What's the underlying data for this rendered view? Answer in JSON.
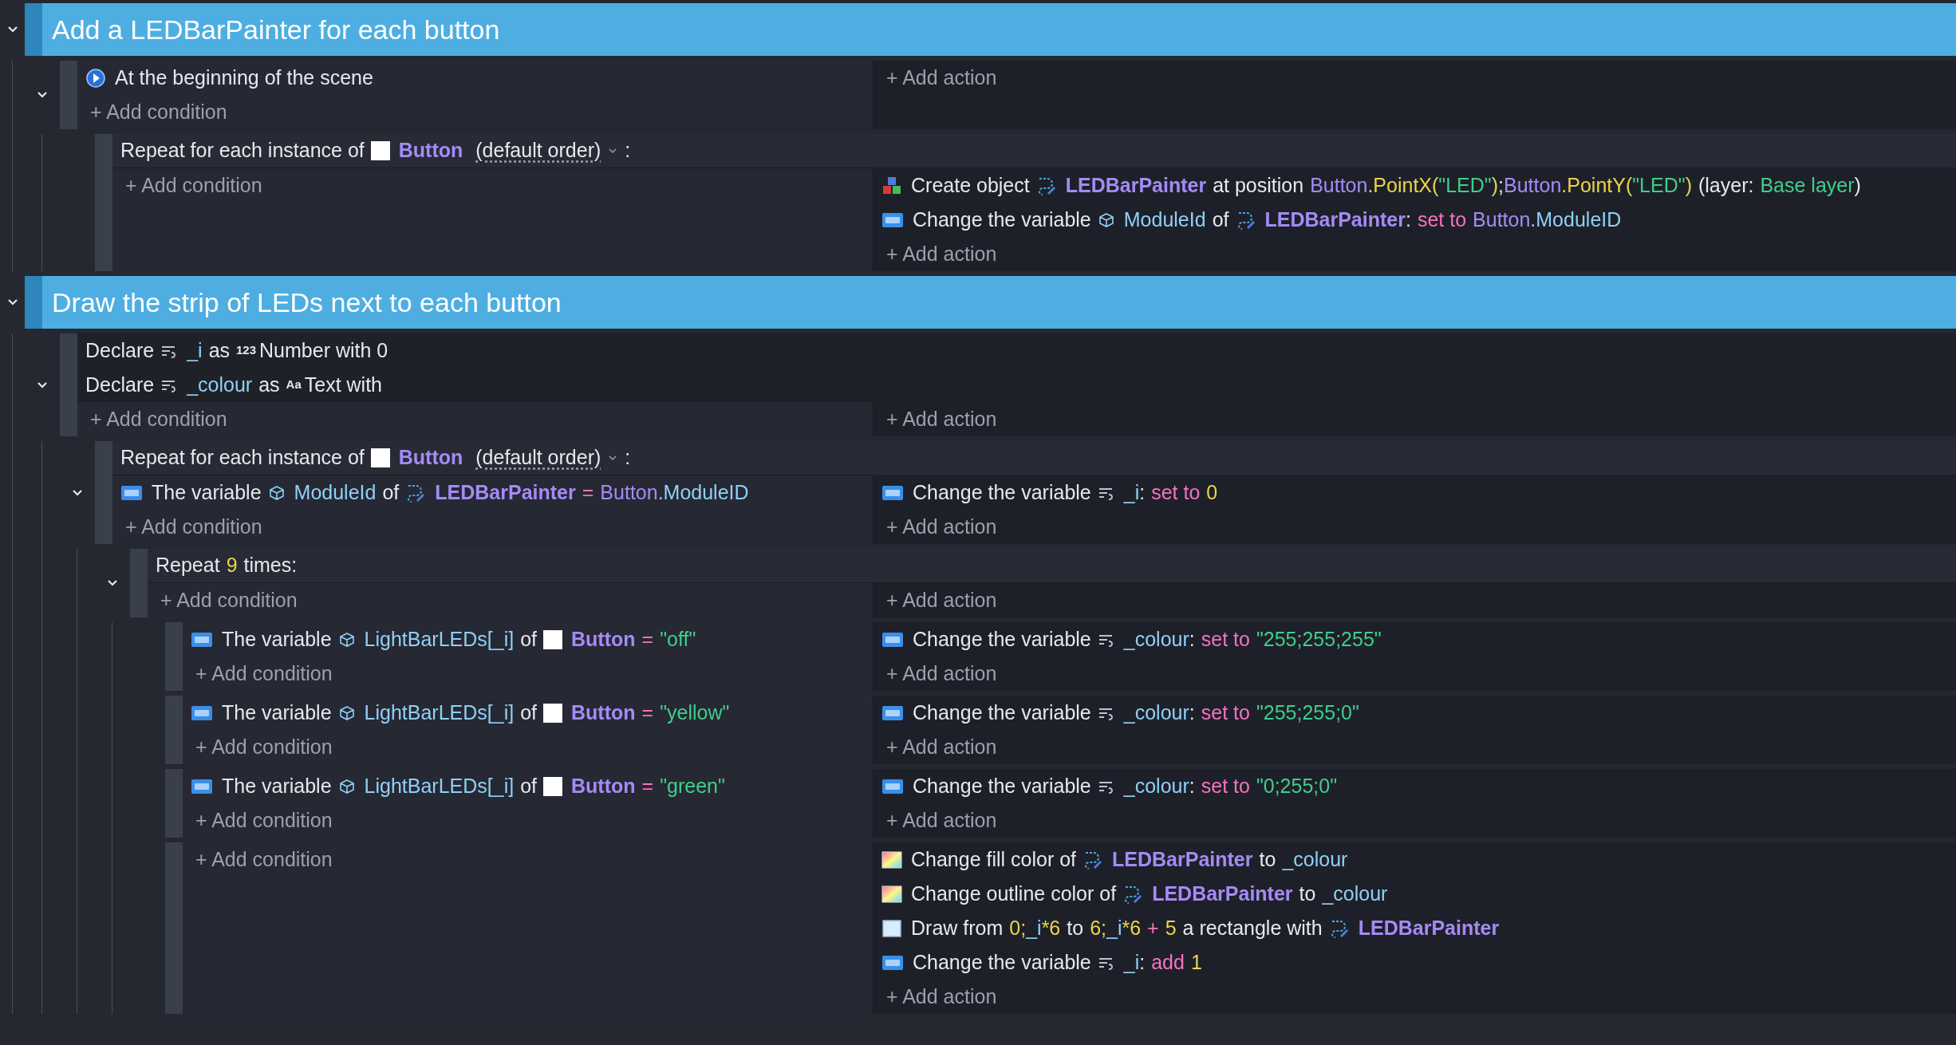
{
  "events": [
    {
      "kind": "comment",
      "text": "Add a LEDBarPainter for each button",
      "expanded": true,
      "children": [
        {
          "kind": "standard",
          "expanded": true,
          "conditions": [
            {
              "kind": "play",
              "parts": [
                {
                  "kind": "text",
                  "text": "At the beginning of the scene"
                }
              ]
            }
          ],
          "add_condition": "+ Add condition",
          "add_action": "+ Add action",
          "children": [
            {
              "kind": "foreach",
              "header": [
                {
                  "kind": "text",
                  "text": "Repeat for each instance of"
                },
                {
                  "kind": "sprite",
                  "text": "Button"
                },
                {
                  "kind": "order",
                  "text": "(default order)"
                },
                {
                  "kind": "caret"
                },
                {
                  "kind": "text",
                  "text": ":"
                }
              ],
              "add_condition": "+ Add condition",
              "actions": [
                {
                  "kind": "create",
                  "parts": [
                    {
                      "kind": "text",
                      "text": "Create object"
                    },
                    {
                      "kind": "painter",
                      "text": "LEDBarPainter"
                    },
                    {
                      "kind": "text",
                      "text": "at position"
                    },
                    {
                      "kind": "expr",
                      "tokens": [
                        {
                          "kind": "obj",
                          "text": "Button"
                        },
                        {
                          "kind": "fn",
                          "text": ".PointX("
                        },
                        {
                          "kind": "str",
                          "text": "\"LED\""
                        },
                        {
                          "kind": "fn",
                          "text": ")"
                        },
                        {
                          "kind": "plain",
                          "text": ";"
                        },
                        {
                          "kind": "obj",
                          "text": "Button"
                        },
                        {
                          "kind": "fn",
                          "text": ".PointY("
                        },
                        {
                          "kind": "str",
                          "text": "\"LED\""
                        },
                        {
                          "kind": "fn",
                          "text": ")"
                        }
                      ]
                    },
                    {
                      "kind": "text",
                      "text": "(layer:"
                    },
                    {
                      "kind": "string",
                      "text": "Base layer"
                    },
                    {
                      "kind": "punct",
                      "text": ")"
                    }
                  ]
                },
                {
                  "kind": "var",
                  "parts": [
                    {
                      "kind": "text",
                      "text": "Change the variable"
                    },
                    {
                      "kind": "objvar",
                      "text": "ModuleId"
                    },
                    {
                      "kind": "text",
                      "text": "of"
                    },
                    {
                      "kind": "painter",
                      "text": "LEDBarPainter"
                    },
                    {
                      "kind": "punct",
                      "text": ":"
                    },
                    {
                      "kind": "op",
                      "text": "set to"
                    },
                    {
                      "kind": "expr",
                      "tokens": [
                        {
                          "kind": "obj",
                          "text": "Button"
                        },
                        {
                          "kind": "member",
                          "text": ".ModuleID"
                        }
                      ]
                    }
                  ]
                }
              ],
              "add_action": "+ Add action"
            }
          ]
        }
      ]
    },
    {
      "kind": "comment",
      "text": "Draw the strip of LEDs next to each button",
      "expanded": true,
      "children": [
        {
          "kind": "standard",
          "expanded": true,
          "declarations": [
            {
              "parts": [
                {
                  "kind": "text",
                  "text": "Declare"
                },
                {
                  "kind": "localvar",
                  "text": "_i"
                },
                {
                  "kind": "text",
                  "text": "as"
                },
                {
                  "kind": "badge",
                  "text": "123"
                },
                {
                  "kind": "text",
                  "text": "Number with 0"
                }
              ]
            },
            {
              "parts": [
                {
                  "kind": "text",
                  "text": "Declare"
                },
                {
                  "kind": "localvar",
                  "text": "_colour"
                },
                {
                  "kind": "text",
                  "text": "as"
                },
                {
                  "kind": "badge",
                  "text": "Aa"
                },
                {
                  "kind": "text",
                  "text": "Text with"
                }
              ]
            }
          ],
          "add_condition": "+ Add condition",
          "add_action": "+ Add action",
          "children": [
            {
              "kind": "foreach",
              "expanded": true,
              "header": [
                {
                  "kind": "text",
                  "text": "Repeat for each instance of"
                },
                {
                  "kind": "sprite",
                  "text": "Button"
                },
                {
                  "kind": "order",
                  "text": "(default order)"
                },
                {
                  "kind": "caret"
                },
                {
                  "kind": "text",
                  "text": ":"
                }
              ],
              "conditions": [
                {
                  "kind": "var",
                  "parts": [
                    {
                      "kind": "text",
                      "text": "The variable"
                    },
                    {
                      "kind": "objvar",
                      "text": "ModuleId"
                    },
                    {
                      "kind": "text",
                      "text": "of"
                    },
                    {
                      "kind": "painter",
                      "text": "LEDBarPainter"
                    },
                    {
                      "kind": "op",
                      "text": "="
                    },
                    {
                      "kind": "expr",
                      "tokens": [
                        {
                          "kind": "obj",
                          "text": "Button"
                        },
                        {
                          "kind": "member",
                          "text": ".ModuleID"
                        }
                      ]
                    }
                  ]
                }
              ],
              "add_condition": "+ Add condition",
              "actions": [
                {
                  "kind": "var",
                  "parts": [
                    {
                      "kind": "text",
                      "text": "Change the variable"
                    },
                    {
                      "kind": "localvar",
                      "text": "_i"
                    },
                    {
                      "kind": "punct",
                      "text": ":"
                    },
                    {
                      "kind": "op",
                      "text": "set to"
                    },
                    {
                      "kind": "number",
                      "text": "0"
                    }
                  ]
                }
              ],
              "add_action": "+ Add action",
              "children": [
                {
                  "kind": "repeat",
                  "expanded": true,
                  "header": [
                    {
                      "kind": "text",
                      "text": "Repeat"
                    },
                    {
                      "kind": "number",
                      "text": "9"
                    },
                    {
                      "kind": "text",
                      "text": "times:"
                    }
                  ],
                  "add_condition": "+ Add condition",
                  "add_action": "+ Add action",
                  "children": [
                    {
                      "kind": "standard",
                      "conditions": [
                        {
                          "kind": "var",
                          "parts": [
                            {
                              "kind": "text",
                              "text": "The variable"
                            },
                            {
                              "kind": "objvar",
                              "text": "LightBarLEDs[_i]"
                            },
                            {
                              "kind": "text",
                              "text": "of"
                            },
                            {
                              "kind": "sprite",
                              "text": "Button"
                            },
                            {
                              "kind": "op",
                              "text": "="
                            },
                            {
                              "kind": "string",
                              "text": "\"off\""
                            }
                          ]
                        }
                      ],
                      "add_condition": "+ Add condition",
                      "actions": [
                        {
                          "kind": "var",
                          "parts": [
                            {
                              "kind": "text",
                              "text": "Change the variable"
                            },
                            {
                              "kind": "localvar",
                              "text": "_colour"
                            },
                            {
                              "kind": "punct",
                              "text": ":"
                            },
                            {
                              "kind": "op",
                              "text": "set to"
                            },
                            {
                              "kind": "string",
                              "text": "\"255;255;255\""
                            }
                          ]
                        }
                      ],
                      "add_action": "+ Add action"
                    },
                    {
                      "kind": "standard",
                      "conditions": [
                        {
                          "kind": "var",
                          "parts": [
                            {
                              "kind": "text",
                              "text": "The variable"
                            },
                            {
                              "kind": "objvar",
                              "text": "LightBarLEDs[_i]"
                            },
                            {
                              "kind": "text",
                              "text": "of"
                            },
                            {
                              "kind": "sprite",
                              "text": "Button"
                            },
                            {
                              "kind": "op",
                              "text": "="
                            },
                            {
                              "kind": "string",
                              "text": "\"yellow\""
                            }
                          ]
                        }
                      ],
                      "add_condition": "+ Add condition",
                      "actions": [
                        {
                          "kind": "var",
                          "parts": [
                            {
                              "kind": "text",
                              "text": "Change the variable"
                            },
                            {
                              "kind": "localvar",
                              "text": "_colour"
                            },
                            {
                              "kind": "punct",
                              "text": ":"
                            },
                            {
                              "kind": "op",
                              "text": "set to"
                            },
                            {
                              "kind": "string",
                              "text": "\"255;255;0\""
                            }
                          ]
                        }
                      ],
                      "add_action": "+ Add action"
                    },
                    {
                      "kind": "standard",
                      "conditions": [
                        {
                          "kind": "var",
                          "parts": [
                            {
                              "kind": "text",
                              "text": "The variable"
                            },
                            {
                              "kind": "objvar",
                              "text": "LightBarLEDs[_i]"
                            },
                            {
                              "kind": "text",
                              "text": "of"
                            },
                            {
                              "kind": "sprite",
                              "text": "Button"
                            },
                            {
                              "kind": "op",
                              "text": "="
                            },
                            {
                              "kind": "string",
                              "text": "\"green\""
                            }
                          ]
                        }
                      ],
                      "add_condition": "+ Add condition",
                      "actions": [
                        {
                          "kind": "var",
                          "parts": [
                            {
                              "kind": "text",
                              "text": "Change the variable"
                            },
                            {
                              "kind": "localvar",
                              "text": "_colour"
                            },
                            {
                              "kind": "punct",
                              "text": ":"
                            },
                            {
                              "kind": "op",
                              "text": "set to"
                            },
                            {
                              "kind": "string",
                              "text": "\"0;255;0\""
                            }
                          ]
                        }
                      ],
                      "add_action": "+ Add action"
                    },
                    {
                      "kind": "standard",
                      "add_condition": "+ Add condition",
                      "actions": [
                        {
                          "kind": "color",
                          "parts": [
                            {
                              "kind": "text",
                              "text": "Change fill color of"
                            },
                            {
                              "kind": "painter",
                              "text": "LEDBarPainter"
                            },
                            {
                              "kind": "text",
                              "text": "to"
                            },
                            {
                              "kind": "varref",
                              "text": "_colour"
                            }
                          ]
                        },
                        {
                          "kind": "color",
                          "parts": [
                            {
                              "kind": "text",
                              "text": "Change outline color of"
                            },
                            {
                              "kind": "painter",
                              "text": "LEDBarPainter"
                            },
                            {
                              "kind": "text",
                              "text": "to"
                            },
                            {
                              "kind": "varref",
                              "text": "_colour"
                            }
                          ]
                        },
                        {
                          "kind": "rect",
                          "parts": [
                            {
                              "kind": "text",
                              "text": "Draw from"
                            },
                            {
                              "kind": "expr",
                              "tokens": [
                                {
                                  "kind": "num",
                                  "text": "0;"
                                },
                                {
                                  "kind": "var",
                                  "text": "_i"
                                },
                                {
                                  "kind": "num",
                                  "text": "*6"
                                }
                              ]
                            },
                            {
                              "kind": "text",
                              "text": "to"
                            },
                            {
                              "kind": "expr",
                              "tokens": [
                                {
                                  "kind": "num",
                                  "text": "6;"
                                },
                                {
                                  "kind": "var",
                                  "text": "_i"
                                },
                                {
                                  "kind": "num",
                                  "text": "*6"
                                }
                              ]
                            },
                            {
                              "kind": "op",
                              "text": "+"
                            },
                            {
                              "kind": "number",
                              "text": "5"
                            },
                            {
                              "kind": "text",
                              "text": "a rectangle with"
                            },
                            {
                              "kind": "painter",
                              "text": "LEDBarPainter"
                            }
                          ]
                        },
                        {
                          "kind": "var",
                          "parts": [
                            {
                              "kind": "text",
                              "text": "Change the variable"
                            },
                            {
                              "kind": "localvar",
                              "text": "_i"
                            },
                            {
                              "kind": "punct",
                              "text": ":"
                            },
                            {
                              "kind": "op",
                              "text": "add"
                            },
                            {
                              "kind": "number",
                              "text": "1"
                            }
                          ]
                        }
                      ],
                      "add_action": "+ Add action"
                    }
                  ]
                }
              ]
            }
          ]
        }
      ]
    }
  ]
}
